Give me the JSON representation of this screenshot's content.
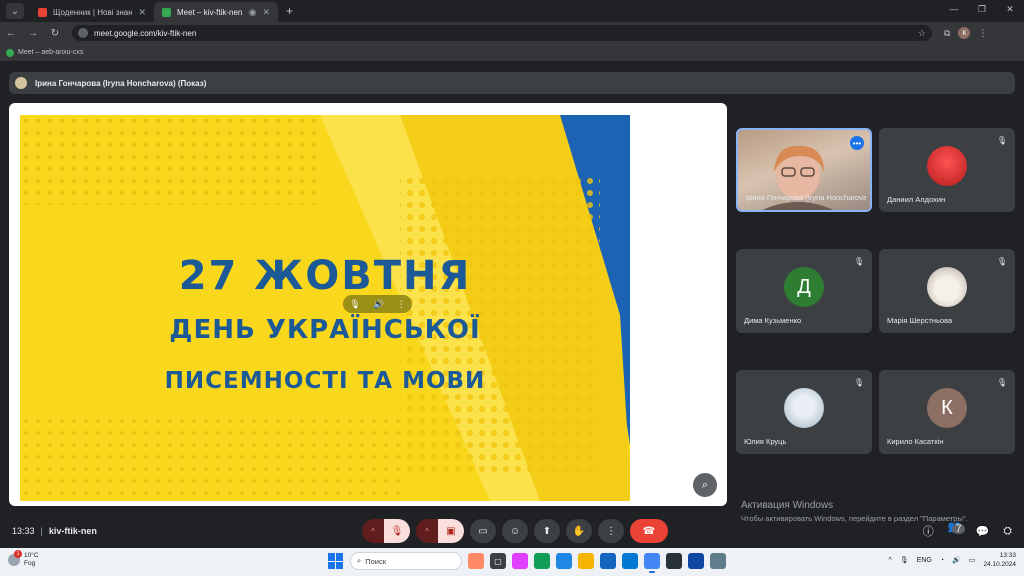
{
  "browser": {
    "tabs": [
      {
        "label": "Щоденник | Нові знання",
        "active": false,
        "color": "#ea4335"
      },
      {
        "label": "Meet – kiv-ftik-nen",
        "active": true,
        "color": "#34a853"
      }
    ],
    "url": "meet.google.com/kiv-ftik-nen",
    "bookmark": "Meet – aeb-anxu-cxs",
    "profile_letter": "К"
  },
  "meet": {
    "presenter_label": "Ірина Гончарова (Iryna Honcharova) (Показ)",
    "slide": {
      "line1": "27 ЖОВТНЯ",
      "line2": "ДЕНЬ УКРАЇНСЬКОЇ",
      "line3": "ПИСЕМНОСТІ ТА МОВИ"
    },
    "participants": [
      {
        "name": "Ірина Гончарова (Iryna Honcharova)",
        "type": "video"
      },
      {
        "name": "Даниил Алдохин",
        "type": "photo"
      },
      {
        "name": "Дима Кузьменко",
        "type": "letter",
        "letter": "Д",
        "color": "#2e7d32"
      },
      {
        "name": "Марія Шерстньова",
        "type": "photo"
      },
      {
        "name": "Юлия Круць",
        "type": "photo"
      },
      {
        "name": "Кирило Касаткін",
        "type": "letter",
        "letter": "К",
        "color": "#8d6e63"
      }
    ],
    "time": "13:33",
    "code": "kiv-ftik-nen",
    "people_count": "7"
  },
  "watermark": {
    "title": "Активация Windows",
    "subtitle": "Чтобы активировать Windows, перейдите в раздел \"Параметры\"."
  },
  "taskbar": {
    "temp": "10°C",
    "weather": "Fog",
    "weather_badge": "1",
    "search_placeholder": "Поиск",
    "lang": "ENG",
    "time": "13:33",
    "date": "24.10.2024"
  }
}
